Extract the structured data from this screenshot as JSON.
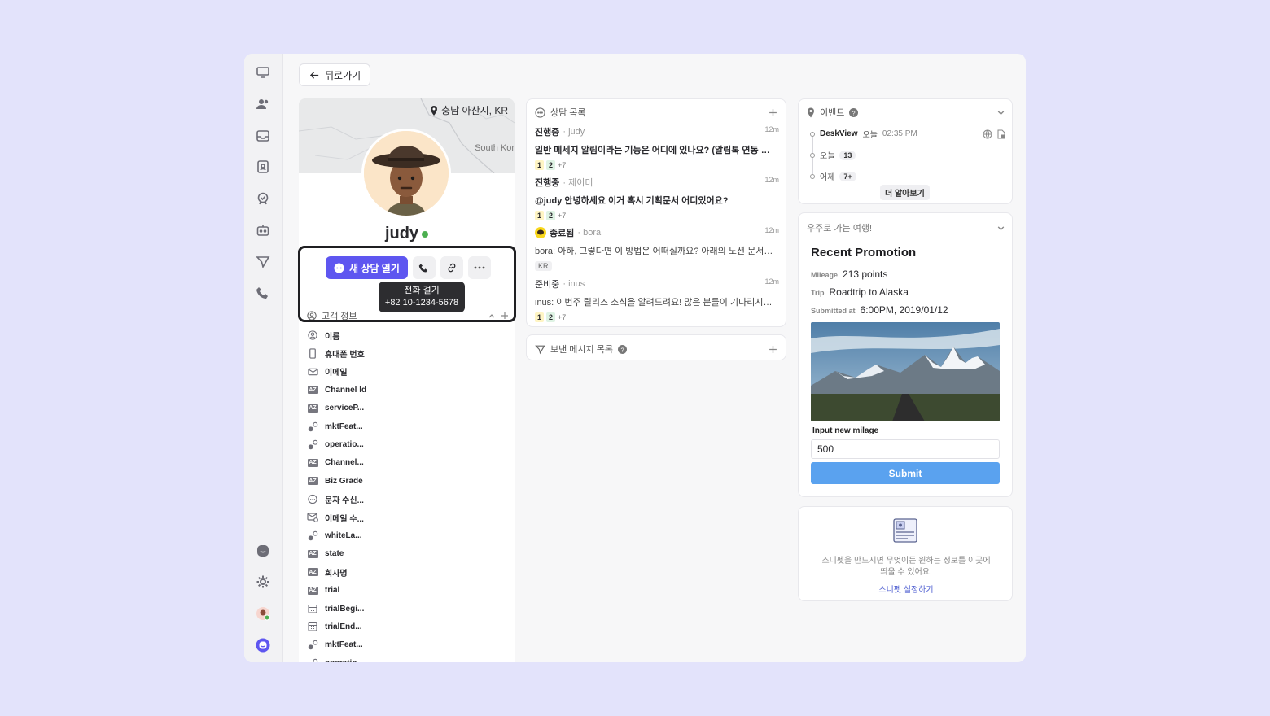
{
  "nav": {
    "back_label": "뒤로가기"
  },
  "profile": {
    "location": "충남 아산시, KR",
    "map_label": "South Kor",
    "username": "judy",
    "new_chat_label": "새 상담 열기",
    "tooltip_title": "전화 걸기",
    "tooltip_phone": "+82 10-1234-5678",
    "section_title": "고객 정보",
    "fields": [
      {
        "icon": "person-icon",
        "label": "이름"
      },
      {
        "icon": "phone-device-icon",
        "label": "휴대폰 번호"
      },
      {
        "icon": "mail-icon",
        "label": "이메일"
      },
      {
        "icon": "text-type-icon",
        "label": "Channel Id"
      },
      {
        "icon": "text-type-icon",
        "label": "serviceP..."
      },
      {
        "icon": "boolean-type-icon",
        "label": "mktFeat..."
      },
      {
        "icon": "boolean-type-icon",
        "label": "operatio..."
      },
      {
        "icon": "text-type-icon",
        "label": "Channel..."
      },
      {
        "icon": "text-type-icon",
        "label": "Biz Grade"
      },
      {
        "icon": "sms-consent-icon",
        "label": "문자 수신..."
      },
      {
        "icon": "mail-consent-icon",
        "label": "이메일 수..."
      },
      {
        "icon": "boolean-type-icon",
        "label": "whiteLa..."
      },
      {
        "icon": "text-type-icon",
        "label": "state"
      },
      {
        "icon": "text-type-icon",
        "label": "회사명"
      },
      {
        "icon": "text-type-icon",
        "label": "trial"
      },
      {
        "icon": "calendar-icon",
        "label": "trialBegi..."
      },
      {
        "icon": "calendar-icon",
        "label": "trialEnd..."
      },
      {
        "icon": "boolean-type-icon",
        "label": "mktFeat..."
      },
      {
        "icon": "boolean-type-icon",
        "label": "operatio..."
      }
    ]
  },
  "chats": {
    "title": "상담 목록",
    "items": [
      {
        "status": "진행중",
        "who": "· judy",
        "time": "12m",
        "message": "일반 메세지 알림이라는 기능은 어디에 있나요? (알림톡 연동 후 사...",
        "badges": [
          "1",
          "2",
          "+7"
        ]
      },
      {
        "status": "진행중",
        "who": "· 제이미",
        "time": "12m",
        "message": "@judy 안녕하세요 이거 혹시 기획문서 어디있어요?",
        "badges": [
          "1",
          "2",
          "+7"
        ]
      },
      {
        "status": "종료됨",
        "who": "· bora",
        "time": "12m",
        "message": "bora: 아하, 그렇다면 이 방법은 어떠실까요? 아래의 노션 문서에...",
        "tag": "KR"
      },
      {
        "status": "준비중",
        "who": "· inus",
        "time": "12m",
        "message": "inus: 이번주 릴리즈 소식을 알려드려요! 많은 분들이 기다리시던 ...",
        "badges": [
          "1",
          "2",
          "+7"
        ]
      }
    ],
    "sent_title": "보낸 메시지 목록"
  },
  "events": {
    "title": "이벤트",
    "rows": [
      {
        "name": "DeskView",
        "when": "오늘",
        "time": "02:35 PM"
      },
      {
        "name": "오늘",
        "count": "13"
      },
      {
        "name": "어제",
        "count": "7+"
      }
    ],
    "more_label": "더 알아보기"
  },
  "promo": {
    "card_title": "우주로 가는 여행!",
    "title": "Recent Promotion",
    "mileage_key": "Mileage",
    "mileage_value": "213 points",
    "trip_key": "Trip",
    "trip_value": "Roadtrip to Alaska",
    "submitted_key": "Submitted at",
    "submitted_value": "6:00PM, 2019/01/12",
    "input_label": "Input new milage",
    "input_value": "500",
    "submit_label": "Submit"
  },
  "snippet": {
    "desc_line1": "스니펫을 만드시면 무엇이든 원하는 정보를 이곳에",
    "desc_line2": "띄울 수 있어요.",
    "link": "스니펫 설정하기"
  },
  "colors": {
    "accent": "#5e56f0",
    "submit": "#5aa2ef",
    "online": "#4caf50",
    "background": "#e3e3fb"
  }
}
